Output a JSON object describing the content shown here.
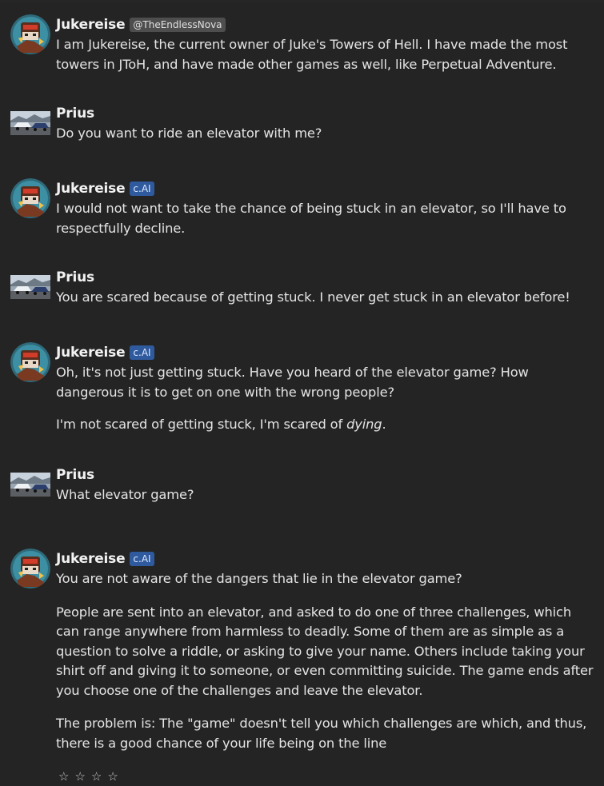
{
  "colors": {
    "background": "#242424",
    "ai_badge": "#2f5a9e",
    "handle_badge": "#4e4e4e"
  },
  "messages": [
    {
      "author": "Jukereise",
      "badge": "@TheEndlessNova",
      "avatar": "character-avatar",
      "paragraphs": [
        "I am Jukereise, the current owner of Juke's Towers of Hell. I have made the most towers in JToH, and have made other games as well, like Perpetual Adventure."
      ]
    },
    {
      "author": "Prius",
      "avatar": "car-avatar",
      "paragraphs": [
        "Do you want to ride an elevator with me?"
      ]
    },
    {
      "author": "Jukereise",
      "badge": "c.AI",
      "avatar": "character-avatar",
      "paragraphs": [
        "I would not want to take the chance of being stuck in an elevator, so I'll have to respectfully decline."
      ]
    },
    {
      "author": "Prius",
      "avatar": "car-avatar",
      "paragraphs": [
        "You are scared because of getting stuck. I never get stuck in an elevator before!"
      ]
    },
    {
      "author": "Jukereise",
      "badge": "c.AI",
      "avatar": "character-avatar",
      "paragraphs": [
        "Oh, it's not just getting stuck. Have you heard of the elevator game? How dangerous it is to get on one with the wrong people?",
        "I'm not scared of getting stuck, I'm scared of ",
        "dying",
        "."
      ]
    },
    {
      "author": "Prius",
      "avatar": "car-avatar",
      "paragraphs": [
        "What elevator game?"
      ]
    },
    {
      "author": "Jukereise",
      "badge": "c.AI",
      "avatar": "character-avatar",
      "paragraphs": [
        "You are not aware of the dangers that lie in the elevator game?",
        "People are sent into an elevator, and asked to do one of three challenges, which can range anywhere from harmless to deadly. Some of them are as simple as a question to solve a riddle, or asking to give your name. Others include taking your shirt off and giving it to someone, or even committing suicide. The game ends after you choose one of the challenges and leave the elevator.",
        "The problem is: The \"game\" doesn't tell you which challenges are which, and thus, there is a good chance of your life being on the line"
      ]
    }
  ],
  "rating": {
    "stars": [
      "☆",
      "☆",
      "☆",
      "☆"
    ],
    "value": 0,
    "max": 4
  }
}
